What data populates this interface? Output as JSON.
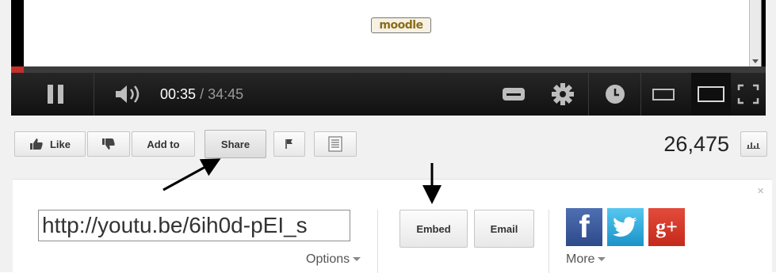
{
  "video": {
    "logo_text": "moodle",
    "progress_fraction": 0.017,
    "current_time": "00:35",
    "time_separator": "/",
    "duration": "34:45"
  },
  "controls": {
    "icons": [
      "pause-icon",
      "volume-icon",
      "captions-icon",
      "gear-icon",
      "clock-icon",
      "small-player-icon",
      "large-player-icon",
      "fullscreen-icon"
    ]
  },
  "actions": {
    "like_label": "Like",
    "add_to_label": "Add to",
    "share_label": "Share",
    "view_count": "26,475"
  },
  "share": {
    "url": "http://youtu.be/6ih0d-pEI_s",
    "options_label": "Options",
    "embed_label": "Embed",
    "email_label": "Email",
    "more_label": "More",
    "close_symbol": "×",
    "social": [
      {
        "name": "facebook",
        "glyph": "f",
        "color": "#3b5998"
      },
      {
        "name": "twitter",
        "glyph": "t",
        "color": "#2fb2e8"
      },
      {
        "name": "google-plus",
        "glyph": "g+",
        "color": "#d73d32"
      }
    ]
  },
  "colors": {
    "progress": "#c4302b",
    "control_bar": "#1b1b1b",
    "panel_bg": "#ffffff",
    "page_bg": "#f1f1f1"
  }
}
